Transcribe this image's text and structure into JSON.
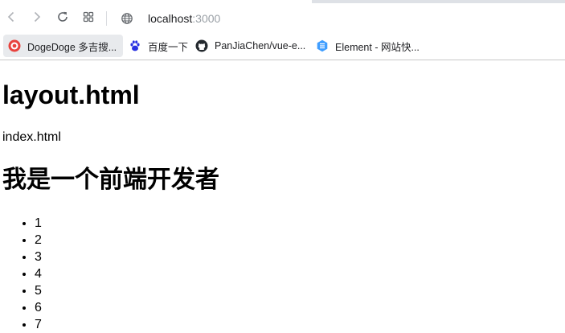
{
  "browser": {
    "url_host": "localhost",
    "url_port": ":3000",
    "bookmarks": [
      {
        "label": "DogeDoge 多吉搜...",
        "icon": "dogedoge-icon"
      },
      {
        "label": "百度一下",
        "icon": "baidu-paw-icon"
      },
      {
        "label": "PanJiaChen/vue-e...",
        "icon": "github-icon"
      },
      {
        "label": "Element - 网站快...",
        "icon": "element-icon"
      }
    ]
  },
  "page": {
    "heading": "layout.html",
    "paragraph": "index.html",
    "subheading": "我是一个前端开发者",
    "list_items": [
      "1",
      "2",
      "3",
      "4",
      "5",
      "6",
      "7"
    ]
  },
  "colors": {
    "dogedoge_red": "#e8423d",
    "baidu_blue": "#2932e1",
    "element_blue": "#409eff"
  }
}
